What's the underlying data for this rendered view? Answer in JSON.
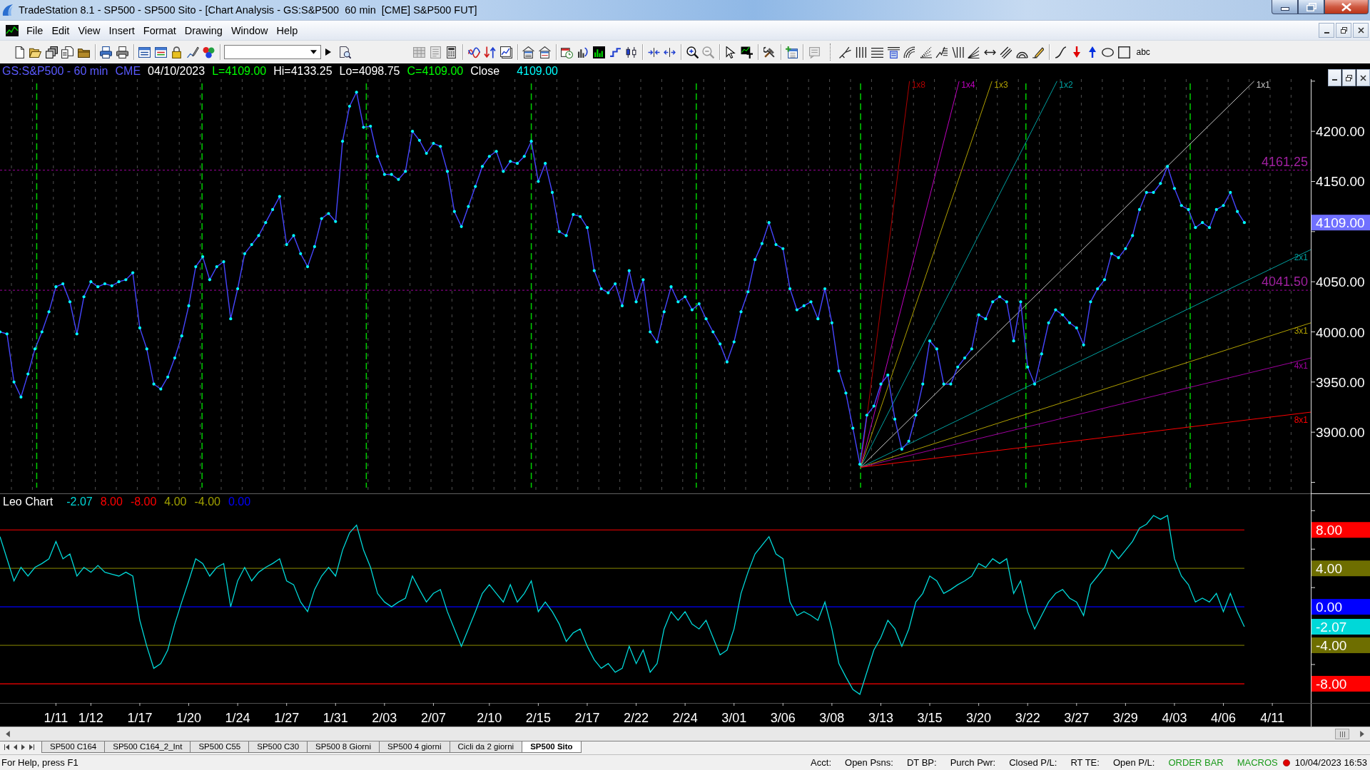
{
  "window": {
    "title": "TradeStation 8.1 - SP500 - SP500 Sito - [Chart Analysis - GS:S&P500  60 min  [CME] S&P500 FUT]"
  },
  "menu": [
    "File",
    "Edit",
    "View",
    "Insert",
    "Format",
    "Drawing",
    "Window",
    "Help"
  ],
  "toolbar": {
    "text_tool": "abc"
  },
  "chart_header": [
    {
      "text": "GS:S&P500 - 60 min",
      "color": "#5a5aff"
    },
    {
      "text": "CME",
      "color": "#5a5aff"
    },
    {
      "text": "04/10/2023",
      "color": "#ffffff"
    },
    {
      "text": "L=4109.00",
      "color": "#00ff00"
    },
    {
      "text": "Hi=4133.25",
      "color": "#ffffff"
    },
    {
      "text": "Lo=4098.75",
      "color": "#ffffff"
    },
    {
      "text": "C=4109.00",
      "color": "#00ff00"
    },
    {
      "text": "Close",
      "color": "#ffffff"
    },
    {
      "text": "4109.00",
      "color": "#00ffff"
    }
  ],
  "price_panel": {
    "gann_fan": [
      {
        "label": "1x8",
        "color": "#b00000"
      },
      {
        "label": "1x4",
        "color": "#c000c0"
      },
      {
        "label": "1x3",
        "color": "#b0a000"
      },
      {
        "label": "1x2",
        "color": "#00a0a0"
      },
      {
        "label": "1x1",
        "color": "#c8c8c8"
      },
      {
        "label": "2x1",
        "color": "#00a0a0"
      },
      {
        "label": "3x1",
        "color": "#b0a000"
      },
      {
        "label": "4x1",
        "color": "#a000a0"
      },
      {
        "label": "8x1",
        "color": "#ff0000"
      }
    ],
    "chart_data": {
      "type": "line",
      "ylim": [
        3839,
        4252
      ],
      "yticks": [
        {
          "value": 3900,
          "label": "3900.00"
        },
        {
          "value": 3950,
          "label": "3950.00"
        },
        {
          "value": 4000,
          "label": "4000.00"
        },
        {
          "value": 4050,
          "label": "4050.00"
        },
        {
          "value": 4150,
          "label": "4150.00"
        },
        {
          "value": 4200,
          "label": "4200.00"
        }
      ],
      "series": [
        {
          "color": "#4646ff",
          "values": [
            4000,
            3998,
            3950,
            3935,
            3958,
            3983,
            4000,
            4020,
            4045,
            4048,
            4030,
            3998,
            4035,
            4050,
            4045,
            4048,
            4046,
            4050,
            4052,
            4059,
            4004,
            3983,
            3948,
            3943,
            3955,
            3974,
            3996,
            4026,
            4065,
            4075,
            4052,
            4065,
            4070,
            4013,
            4043,
            4078,
            4087,
            4096,
            4109,
            4122,
            4135,
            4087,
            4096,
            4078,
            4065,
            4085,
            4113,
            4118,
            4110,
            4190,
            4225,
            4239,
            4204,
            4205,
            4175,
            4157,
            4157,
            4152,
            4160,
            4200,
            4191,
            4178,
            4188,
            4185,
            4160,
            4120,
            4105,
            4125,
            4145,
            4165,
            4175,
            4180,
            4160,
            4170,
            4168,
            4175,
            4190,
            4150,
            4168,
            4139,
            4100,
            4096,
            4117,
            4115,
            4104,
            4061,
            4043,
            4039,
            4048,
            4026,
            4061,
            4030,
            4052,
            4000,
            3990,
            4020,
            4045,
            4030,
            4035,
            4022,
            4028,
            4013,
            4000,
            3988,
            3970,
            3990,
            4020,
            4040,
            4072,
            4088,
            4109,
            4087,
            4083,
            4043,
            4022,
            4026,
            4030,
            4013,
            4043,
            4009,
            3961,
            3939,
            3904,
            3868,
            3917,
            3926,
            3948,
            3957,
            3913,
            3883,
            3891,
            3917,
            3948,
            3991,
            3983,
            3948,
            3948,
            3965,
            3974,
            3983,
            4017,
            4013,
            4030,
            4035,
            4030,
            3991,
            4030,
            3965,
            3948,
            3978,
            4009,
            4022,
            4017,
            4009,
            4004,
            3987,
            4030,
            4043,
            4052,
            4078,
            4074,
            4083,
            4096,
            4122,
            4139,
            4139,
            4148,
            4165,
            4143,
            4126,
            4122,
            4104,
            4109,
            4104,
            4122,
            4126,
            4139,
            4120,
            4109
          ]
        }
      ],
      "ref_lines": [
        {
          "axis": "y",
          "value": 4161.25,
          "label": "4161.25"
        },
        {
          "axis": "y",
          "value": 4041.5,
          "label": "4041.50"
        }
      ],
      "annotations": [
        "4109.00"
      ]
    }
  },
  "oscillator_panel": {
    "legend": [
      {
        "text": "-2.07",
        "color": "#00d8d8"
      },
      {
        "text": "8.00",
        "color": "#ff0000"
      },
      {
        "text": "-8.00",
        "color": "#ff0000"
      },
      {
        "text": "4.00",
        "color": "#a0a000"
      },
      {
        "text": "-4.00",
        "color": "#a0a000"
      },
      {
        "text": "0.00",
        "color": "#0000ff"
      }
    ],
    "chart_data": {
      "type": "line",
      "ylim": [
        -10,
        11.8
      ],
      "categories": [
        null,
        null,
        null,
        null,
        null,
        null,
        null,
        null,
        "1/11",
        null,
        null,
        null,
        null,
        "1/12",
        null,
        null,
        null,
        null,
        null,
        null,
        "1/17",
        null,
        null,
        null,
        null,
        null,
        null,
        "1/20",
        null,
        null,
        null,
        null,
        null,
        null,
        "1/24",
        null,
        null,
        null,
        null,
        null,
        null,
        "1/27",
        null,
        null,
        null,
        null,
        null,
        null,
        "1/31",
        null,
        null,
        null,
        null,
        null,
        null,
        "2/03",
        null,
        null,
        null,
        null,
        null,
        null,
        "2/07",
        null,
        null,
        null,
        null,
        null,
        null,
        null,
        "2/10",
        null,
        null,
        null,
        null,
        null,
        null,
        "2/15",
        null,
        null,
        null,
        null,
        null,
        null,
        "2/17",
        null,
        null,
        null,
        null,
        null,
        null,
        "2/22",
        null,
        null,
        null,
        null,
        null,
        null,
        "2/24",
        null,
        null,
        null,
        null,
        null,
        null,
        "3/01",
        null,
        null,
        null,
        null,
        null,
        null,
        "3/06",
        null,
        null,
        null,
        null,
        null,
        null,
        "3/08",
        null,
        null,
        null,
        null,
        null,
        null,
        "3/13",
        null,
        null,
        null,
        null,
        null,
        null,
        "3/15",
        null,
        null,
        null,
        null,
        null,
        null,
        "3/20",
        null,
        null,
        null,
        null,
        null,
        null,
        "3/22",
        null,
        null,
        null,
        null,
        null,
        null,
        "3/27",
        null,
        null,
        null,
        null,
        null,
        null,
        "3/29",
        null,
        null,
        null,
        null,
        null,
        null,
        "4/03",
        null,
        null,
        null,
        null,
        null,
        null,
        "4/06",
        null,
        null,
        null,
        null,
        null,
        null,
        "4/11"
      ],
      "yticks": [
        {
          "value": 8,
          "label": "8.00"
        },
        {
          "value": 4,
          "label": "4.00"
        },
        {
          "value": 0,
          "label": "0.00"
        },
        {
          "value": -4,
          "label": "-4.00"
        },
        {
          "value": -8,
          "label": "-8.00"
        }
      ],
      "series": [
        {
          "name": "Leo Chart",
          "color": "#00d8d8",
          "values": [
            7.3,
            5,
            2.7,
            4.1,
            3.2,
            4.1,
            4.5,
            5,
            6.8,
            5,
            5.5,
            3.2,
            4.1,
            3.6,
            4.3,
            3.6,
            3.4,
            3.2,
            3.6,
            3.2,
            -1.4,
            -4.1,
            -6.4,
            -5.9,
            -4.5,
            -1.8,
            0.5,
            2.7,
            5,
            4.5,
            3.2,
            4.1,
            4.5,
            0,
            2.7,
            4.1,
            2.7,
            3.6,
            4.1,
            4.5,
            5,
            2.7,
            2.3,
            0.5,
            -0.5,
            1.8,
            3.2,
            4.1,
            3.2,
            5.9,
            7.7,
            8.5,
            5.9,
            4.1,
            1.4,
            0.5,
            0,
            0.5,
            0.9,
            3.2,
            1.8,
            0.5,
            1.4,
            1.8,
            -0.5,
            -2.3,
            -4.1,
            -2.3,
            -0.5,
            1.4,
            2.3,
            1.4,
            0.5,
            2.3,
            0.5,
            1.4,
            2.7,
            -0.5,
            0.5,
            -0.5,
            -1.8,
            -3.6,
            -2.7,
            -2.3,
            -4.1,
            -5.5,
            -6.4,
            -5.9,
            -6.8,
            -6.4,
            -4.1,
            -5.9,
            -4.5,
            -6.8,
            -5.9,
            -2.3,
            -0.5,
            -1.4,
            -0.5,
            -1.8,
            -2.3,
            -1.4,
            -3.2,
            -5,
            -4.5,
            -2.3,
            1.4,
            3.6,
            5.5,
            6.4,
            7.3,
            5.5,
            5,
            0.5,
            -0.9,
            -0.5,
            -0.9,
            -1.4,
            0.5,
            -2.3,
            -5.9,
            -7.3,
            -8.6,
            -9.1,
            -6.8,
            -4.5,
            -3.2,
            -1.4,
            -2.3,
            -4.1,
            -2.3,
            0.5,
            1.4,
            3.2,
            2.7,
            1.4,
            1.8,
            2.3,
            2.7,
            3.2,
            4.5,
            4.1,
            5,
            4.5,
            5,
            1.4,
            2.7,
            -0.5,
            -2.3,
            -0.9,
            0.5,
            1.4,
            1.8,
            0.9,
            0.5,
            -0.9,
            2.3,
            3.2,
            4.1,
            5.9,
            5,
            5.9,
            6.8,
            8.2,
            8.6,
            9.5,
            9.1,
            9.5,
            5,
            3.2,
            2.3,
            0.5,
            0.9,
            0.5,
            1.4,
            -0.5,
            1.4,
            -0.5,
            -2.07,
            null,
            null,
            null,
            null
          ]
        }
      ],
      "ref_lines": [
        {
          "axis": "y",
          "value": 8,
          "color": "#ff0000"
        },
        {
          "axis": "y",
          "value": 4,
          "color": "#6e6e00"
        },
        {
          "axis": "y",
          "value": 0,
          "color": "#0000ff"
        },
        {
          "axis": "y",
          "value": -4,
          "color": "#6e6e00"
        },
        {
          "axis": "y",
          "value": -8,
          "color": "#ff0000"
        }
      ],
      "annotations": [
        "-2.07"
      ]
    }
  },
  "sheet_tabs": [
    {
      "label": "SP500 C164",
      "selected": false
    },
    {
      "label": "SP500 C164_2_Int",
      "selected": false
    },
    {
      "label": "SP500 C55",
      "selected": false
    },
    {
      "label": "SP500 C30",
      "selected": false
    },
    {
      "label": "SP500 8 Giorni",
      "selected": false
    },
    {
      "label": "SP500 4 giorni",
      "selected": false
    },
    {
      "label": "Cicli da 2 giorni",
      "selected": false
    },
    {
      "label": "SP500 Sito",
      "selected": true
    }
  ],
  "status_bar": {
    "help": "For Help, press F1",
    "fields": [
      "Acct:",
      "Open Psns:",
      "DT BP:",
      "Purch Pwr:",
      "Closed P/L:",
      "RT TE:",
      "Open P/L:"
    ],
    "indicators": [
      "ORDER BAR",
      "MACROS"
    ],
    "datetime": "10/04/2023 16:53"
  }
}
